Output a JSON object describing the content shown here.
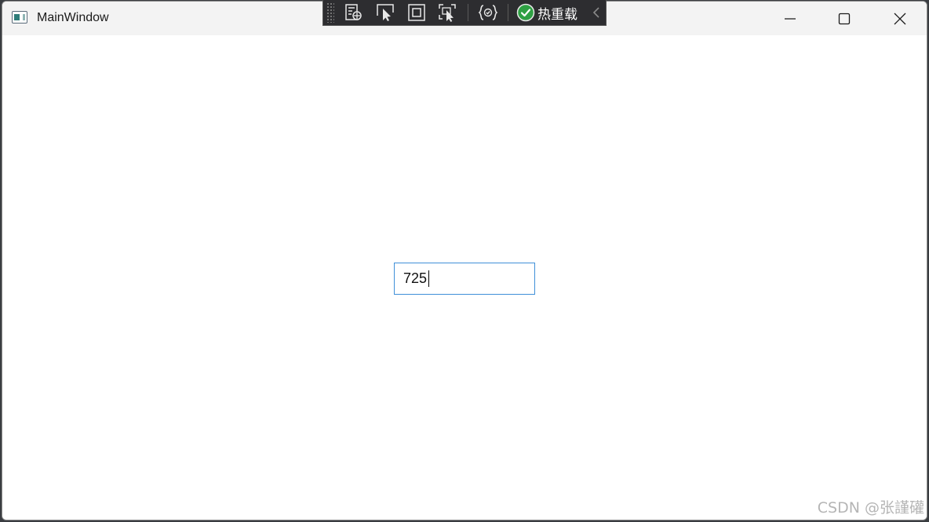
{
  "window": {
    "title": "MainWindow",
    "icon": "wpf-window-icon"
  },
  "caption_buttons": [
    {
      "name": "minimize",
      "icon": "minimize-icon"
    },
    {
      "name": "maximize",
      "icon": "maximize-icon"
    },
    {
      "name": "close",
      "icon": "close-icon"
    }
  ],
  "debug_toolbar": {
    "tools": [
      {
        "name": "live-visual-tree",
        "icon": "visual-tree-icon"
      },
      {
        "name": "select-element",
        "icon": "select-element-icon"
      },
      {
        "name": "display-layout-adorners",
        "icon": "layout-adorner-icon"
      },
      {
        "name": "track-focused-element",
        "icon": "track-focus-icon"
      },
      {
        "name": "binding-failures",
        "icon": "binding-failures-icon"
      }
    ],
    "hot_reload_label": "热重载",
    "hot_reload_status_icon": "check-circle-icon",
    "collapse_icon": "chevron-left-icon",
    "colors": {
      "background": "#2d2d30",
      "hot_reload_ok": "#2ea043"
    }
  },
  "textbox": {
    "value": "725",
    "border_color": "#3f8fd8"
  },
  "watermark": "CSDN @张謹礶"
}
